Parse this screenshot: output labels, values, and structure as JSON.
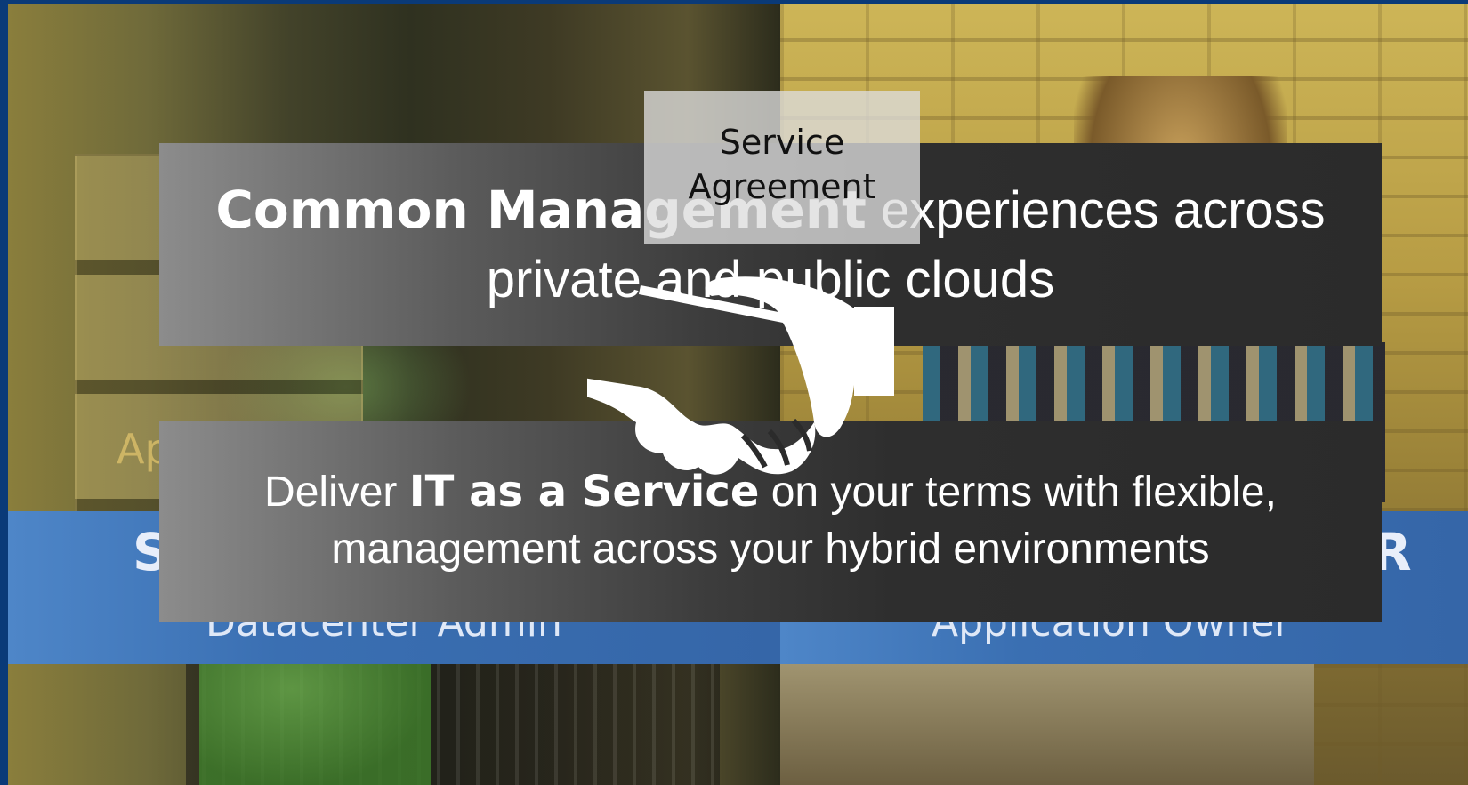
{
  "slide": {
    "left_panel": {
      "ghost_text": "Ap",
      "bar_big": "S",
      "role": "Datacenter Admin"
    },
    "right_panel": {
      "bar_big": "R",
      "role": "Application Owner"
    },
    "top_message": {
      "bold": "Common Management",
      "rest_line1": " experiences across",
      "line2": "private and public clouds"
    },
    "bottom_message": {
      "prefix": "Deliver ",
      "bold": "IT as a Service",
      "rest_line1": " on your terms with flexible,",
      "line2": "management across your hybrid environments"
    },
    "agreement": {
      "line1": "Service",
      "line2": "Agreement"
    },
    "colors": {
      "bar_blue": "#3a6fb2",
      "message_dark": "#2b2b2b",
      "background_blue": "#0a3a78"
    },
    "icon": "handshake-icon"
  }
}
